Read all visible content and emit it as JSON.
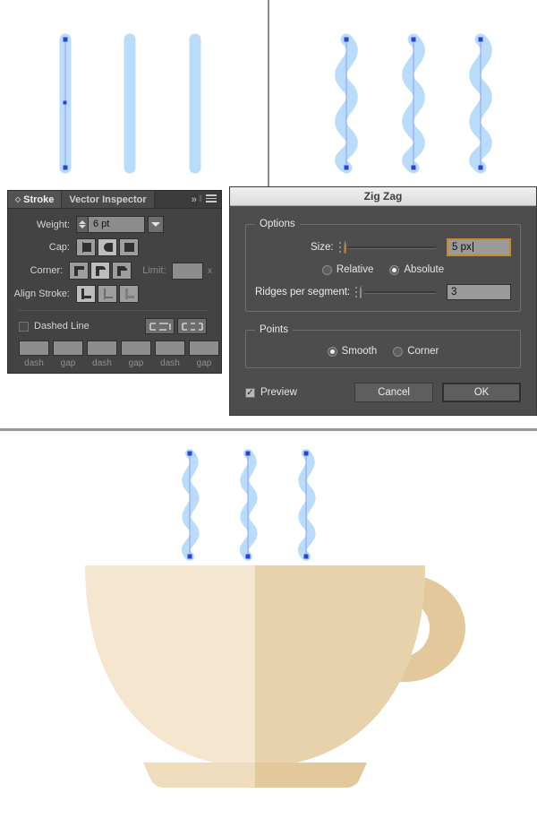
{
  "artwork": {
    "stroke_color": "#b9dcfa",
    "anchor_color": "#2b44d8",
    "path_line_color": "#8f9ef0",
    "cup_light": "#f5e6cf",
    "cup_dark": "#e8d2ab",
    "saucer_light": "#efdcbd",
    "saucer_dark": "#e2c89b",
    "handle_color": "#e2c89b",
    "straight_lines_count": 3,
    "wave_shapes_top_count": 3,
    "wave_shapes_cup_count": 3
  },
  "stroke_panel": {
    "tabs": [
      {
        "label": "Stroke",
        "active": true
      },
      {
        "label": "Vector Inspector",
        "active": false
      }
    ],
    "tools": {
      "expand": "»",
      "divider": "‖",
      "menu": "menu-icon"
    },
    "weight": {
      "label": "Weight:",
      "value": "6 pt"
    },
    "cap": {
      "label": "Cap:",
      "options": [
        "butt-cap",
        "round-cap",
        "projecting-cap"
      ],
      "selected_index": 1
    },
    "corner": {
      "label": "Corner:",
      "options": [
        "miter-join",
        "round-join",
        "bevel-join"
      ],
      "selected_index": 1
    },
    "limit": {
      "label": "Limit:",
      "value": "",
      "unit": "x"
    },
    "align_stroke": {
      "label": "Align Stroke:",
      "options": [
        "align-center",
        "align-inside",
        "align-outside"
      ],
      "selected_index": 0
    },
    "dashed_line": {
      "label": "Dashed Line",
      "checked": false
    },
    "dash_pattern_buttons": [
      "preserve-exact-dash",
      "adjust-dash-to-corners"
    ],
    "dash_fields": [
      {
        "caption": "dash",
        "value": ""
      },
      {
        "caption": "gap",
        "value": ""
      },
      {
        "caption": "dash",
        "value": ""
      },
      {
        "caption": "gap",
        "value": ""
      },
      {
        "caption": "dash",
        "value": ""
      },
      {
        "caption": "gap",
        "value": ""
      }
    ]
  },
  "zigzag_dialog": {
    "title": "Zig Zag",
    "options_group": {
      "legend": "Options",
      "size": {
        "label": "Size:",
        "value": "5 px",
        "slider_percent": 4
      },
      "mode": {
        "options": [
          "Relative",
          "Absolute"
        ],
        "selected": "Absolute"
      },
      "ridges": {
        "label": "Ridges per segment:",
        "value": "3",
        "slider_percent": 3
      }
    },
    "points_group": {
      "legend": "Points",
      "options": [
        "Smooth",
        "Corner"
      ],
      "selected": "Smooth"
    },
    "preview": {
      "label": "Preview",
      "checked": true,
      "mark": "✓"
    },
    "buttons": {
      "cancel": "Cancel",
      "ok": "OK"
    },
    "accent_color": "#c98a2e"
  }
}
